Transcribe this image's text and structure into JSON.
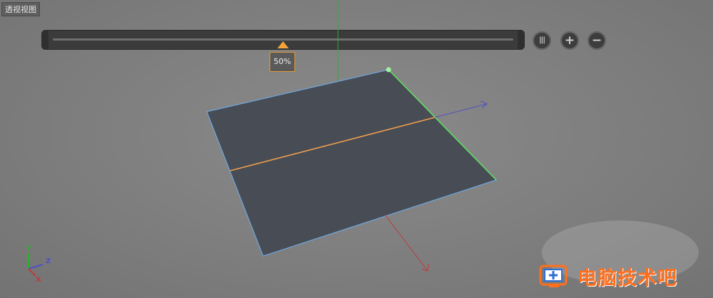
{
  "viewport": {
    "label": "透视视图"
  },
  "zoom": {
    "value": "50%",
    "level": 0.5
  },
  "toolbar": {
    "pause_icon": "pause-icon",
    "zoom_in_icon": "plus-icon",
    "zoom_out_icon": "minus-icon"
  },
  "axes": {
    "x": "X",
    "y": "Y",
    "z": "Z"
  },
  "colors": {
    "background": "#808080",
    "plane_fill": "#484c54",
    "plane_edge": "#6fa7dd",
    "selected_edge": "#5fe05f",
    "mid_edge": "#f0a050",
    "y_axis": "#2fae2f",
    "x_axis": "#c03a3a",
    "z_axis": "#5050c8",
    "accent": "#f2a33a",
    "watermark": "#ff6f1e"
  },
  "watermark": {
    "text": "电脑技术吧",
    "logo_icon": "computer-plus-logo"
  }
}
